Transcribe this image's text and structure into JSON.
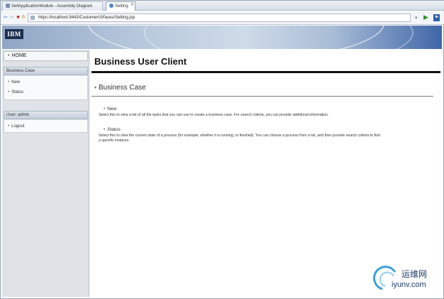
{
  "tabs": [
    {
      "label": "SellApplicationModule - Assembly Diagram",
      "active": false
    },
    {
      "label": "Setting",
      "active": true
    }
  ],
  "address": {
    "url": "https://localhost:9443/CustomerUI/faces/Setting.jsp"
  },
  "banner": {
    "logo": "IBM"
  },
  "sidebar": {
    "home_label": "HOME",
    "sections": [
      {
        "title": "Business Case",
        "links": [
          "New",
          "Status"
        ]
      },
      {
        "title": "User: admin",
        "links": [
          "Logout"
        ]
      }
    ]
  },
  "main": {
    "page_title": "Business User Client",
    "section_title": "Business Case",
    "items": [
      {
        "title": "New",
        "description": "Select this to view a list of all the tasks that you can use to create a business case. For search criteria, you can provide additional information."
      },
      {
        "title": "Status",
        "description": "Select this to view the current state of a process (for example, whether it is running, or finished). You can choose a process from a list, and then provide search criteria to find a specific instance."
      }
    ]
  },
  "watermark": {
    "cn": "运维网",
    "en": "iyunv.com"
  },
  "colors": {
    "banner_accent": "#3f66a8",
    "rule": "#111111",
    "sidebar_bg": "#dfe3e8"
  }
}
